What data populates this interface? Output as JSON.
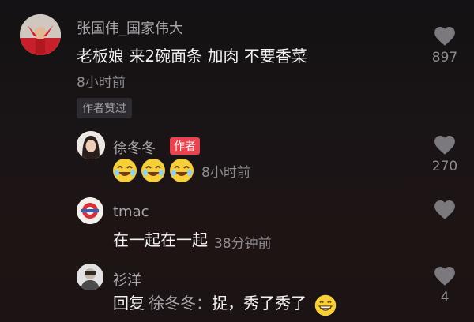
{
  "comments": [
    {
      "username": "张国伟_国家伟大",
      "text": "老板娘 来2碗面条 加肉 不要香菜",
      "time": "8小时前",
      "badge": "作者赞过",
      "likes": "897"
    },
    {
      "username": "徐冬冬",
      "author_tag": "作者",
      "time": "8小时前",
      "likes": "270",
      "emoji_icons": [
        "laughing-emoji-icon",
        "laughing-emoji-icon",
        "laughing-emoji-icon"
      ]
    },
    {
      "username": "tmac",
      "text": "在一起在一起",
      "time": "38分钟前",
      "likes": ""
    },
    {
      "username": "衫洋",
      "reply_prefix": "回复",
      "reply_to": "徐冬冬：",
      "text": "捉，秀了秀了",
      "likes": "4"
    }
  ],
  "colors": {
    "background": "#161214",
    "username": "#a9a6ab",
    "body_text": "#f2f2f2",
    "muted": "#8e8b90",
    "author_tag": "#e8434f",
    "badge_bg": "#2e2b30"
  }
}
